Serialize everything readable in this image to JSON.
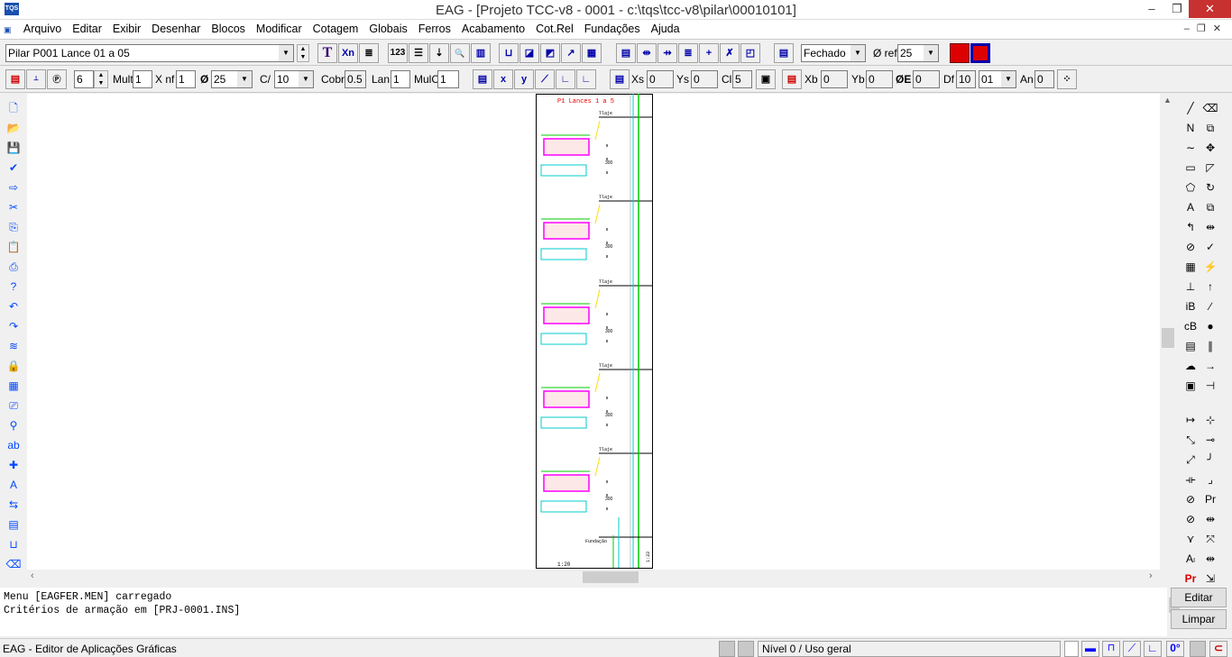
{
  "window": {
    "title": "EAG - [Projeto TCC-v8 - 0001 - c:\\tqs\\tcc-v8\\pilar\\00010101]",
    "app_icon": "TQS",
    "minimize": "–",
    "maximize": "❐",
    "close": "✕"
  },
  "menu": [
    "Arquivo",
    "Editar",
    "Exibir",
    "Desenhar",
    "Blocos",
    "Modificar",
    "Cotagem",
    "Globais",
    "Ferros",
    "Acabamento",
    "Cot.Rel",
    "Fundações",
    "Ajuda"
  ],
  "toolbar1": {
    "pilar_select": "Pilar P001 Lance 01 a 05",
    "buttons": [
      "T",
      "Xn",
      "≣",
      "123",
      "☰",
      "⇣",
      "🔍",
      "▥"
    ],
    "fechado_select": "Fechado",
    "oref_label": "Ø ref",
    "oref_value": "25"
  },
  "toolbar2": {
    "n_value": "6",
    "mult_label": "Mult",
    "mult_value": "1",
    "xnf_label": "X nf",
    "xnf_value": "1",
    "phi_label": "Ø",
    "phi_value": "25",
    "c_label": "C/",
    "c_value": "10",
    "cobr_label": "Cobr",
    "cobr_value": "0.5",
    "lan_label": "Lan",
    "lan_value": "1",
    "mulc_label": "MulC",
    "mulc_value": "1",
    "xs_label": "Xs",
    "xs_value": "0",
    "ys_label": "Ys",
    "ys_value": "0",
    "cl_label": "Cl",
    "cl_value": "5",
    "xb_label": "Xb",
    "xb_value": "0",
    "yb_label": "Yb",
    "yb_value": "0",
    "oe_label": "ØE",
    "oe_value": "0",
    "df_label": "Df",
    "df_value": "10",
    "df_select": "01",
    "an_label": "An",
    "an_value": "0"
  },
  "left_tools": [
    "new-icon",
    "open-icon",
    "save-icon",
    "check-icon",
    "enter-icon",
    "cut-icon",
    "copy-icon",
    "paste-icon",
    "print-icon",
    "help-icon",
    "undo-icon",
    "redo-icon",
    "layers-icon",
    "lock-icon",
    "colors-icon",
    "plot-icon",
    "binoculars-icon",
    "replace-text-icon",
    "add-icon",
    "text-style-icon",
    "swap-icon",
    "properties-icon",
    "window-icon",
    "eraser-icon"
  ],
  "right_tools": [
    "line-icon",
    "erase-icon",
    "polyline-icon",
    "stretch-icon",
    "spline-icon",
    "move-icon",
    "rectangle-icon",
    "mirror-icon",
    "polygon-icon",
    "rotate-icon",
    "text-icon",
    "scale-icon",
    "arc-icon",
    "break-icon",
    "circle-icon",
    "trim-icon",
    "hatch-icon",
    "extend-icon",
    "block-icon",
    "offset-icon",
    "insert-block-icon",
    "chamfer-icon",
    "copy-block-icon",
    "fillet-dot-icon",
    "list-icon",
    "parallel-icon",
    "cloud-icon",
    "join-icon",
    "image-icon",
    "explode-icon"
  ],
  "right_tools2": [
    "dim-horizontal-icon",
    "dim-vertical-icon",
    "dim-aligned-icon",
    "dim-continue-icon",
    "dim-diagonal-icon",
    "dim-break-icon",
    "dim-multiple-icon",
    "dim-arc-icon",
    "dim-diameter-icon",
    "dim-radius-icon",
    "dim-angle-icon",
    "dim-elev-icon",
    "leader-icon",
    "dim-leader-e-icon",
    "Pr",
    "dim-edit-icon"
  ],
  "drawing": {
    "title": "P1 Lances 1 a 5",
    "level_label": "Tlaje",
    "foundation_label": "Fundação",
    "scale_left": "1:20",
    "scale_right": "1:33",
    "lance_height": "300"
  },
  "messages": [
    "Menu [EAGFER.MEN] carregado",
    "Critérios de armação em [PRJ-0001.INS]"
  ],
  "buttons": {
    "edit": "Editar",
    "clear": "Limpar"
  },
  "status": {
    "app": "EAG - Editor de Aplicações Gráficas",
    "level": "Nível 0 / Uso geral",
    "angle": "0°"
  }
}
